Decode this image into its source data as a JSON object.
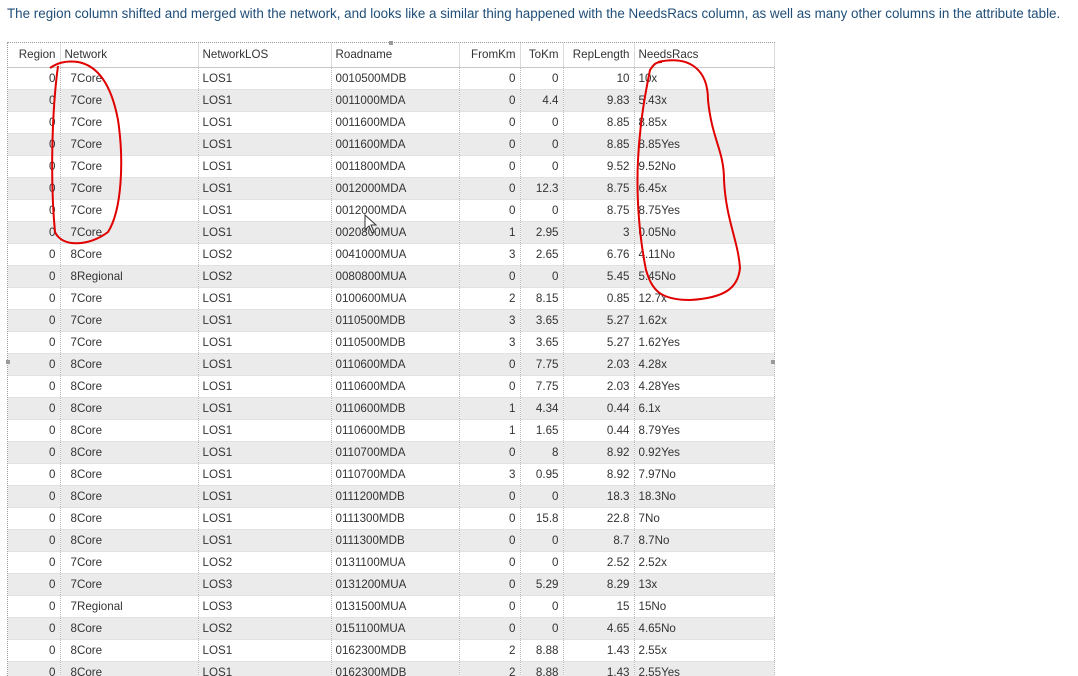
{
  "note": "The region column shifted and merged with the network, and looks like a similar thing happened with the NeedsRacs column, as well as many other columns in the attribute table.",
  "columns": [
    "Region",
    "Network",
    "NetworkLOS",
    "Roadname",
    "FromKm",
    "ToKm",
    "RepLength",
    "NeedsRacs"
  ],
  "rows": [
    [
      "0",
      "7Core",
      "LOS1",
      "0010500MDB",
      "0",
      "0",
      "10",
      "10x"
    ],
    [
      "0",
      "7Core",
      "LOS1",
      "0011000MDA",
      "0",
      "4.4",
      "9.83",
      "5.43x"
    ],
    [
      "0",
      "7Core",
      "LOS1",
      "0011600MDA",
      "0",
      "0",
      "8.85",
      "8.85x"
    ],
    [
      "0",
      "7Core",
      "LOS1",
      "0011600MDA",
      "0",
      "0",
      "8.85",
      "8.85Yes"
    ],
    [
      "0",
      "7Core",
      "LOS1",
      "0011800MDA",
      "0",
      "0",
      "9.52",
      "9.52No"
    ],
    [
      "0",
      "7Core",
      "LOS1",
      "0012000MDA",
      "0",
      "12.3",
      "8.75",
      "6.45x"
    ],
    [
      "0",
      "7Core",
      "LOS1",
      "0012000MDA",
      "0",
      "0",
      "8.75",
      "8.75Yes"
    ],
    [
      "0",
      "7Core",
      "LOS1",
      "0020800MUA",
      "1",
      "2.95",
      "3",
      "0.05No"
    ],
    [
      "0",
      "8Core",
      "LOS2",
      "0041000MUA",
      "3",
      "2.65",
      "6.76",
      "4.11No"
    ],
    [
      "0",
      "8Regional",
      "LOS2",
      "0080800MUA",
      "0",
      "0",
      "5.45",
      "5.45No"
    ],
    [
      "0",
      "7Core",
      "LOS1",
      "0100600MUA",
      "2",
      "8.15",
      "0.85",
      "12.7x"
    ],
    [
      "0",
      "7Core",
      "LOS1",
      "0110500MDB",
      "3",
      "3.65",
      "5.27",
      "1.62x"
    ],
    [
      "0",
      "7Core",
      "LOS1",
      "0110500MDB",
      "3",
      "3.65",
      "5.27",
      "1.62Yes"
    ],
    [
      "0",
      "8Core",
      "LOS1",
      "0110600MDA",
      "0",
      "7.75",
      "2.03",
      "4.28x"
    ],
    [
      "0",
      "8Core",
      "LOS1",
      "0110600MDA",
      "0",
      "7.75",
      "2.03",
      "4.28Yes"
    ],
    [
      "0",
      "8Core",
      "LOS1",
      "0110600MDB",
      "1",
      "4.34",
      "0.44",
      "6.1x"
    ],
    [
      "0",
      "8Core",
      "LOS1",
      "0110600MDB",
      "1",
      "1.65",
      "0.44",
      "8.79Yes"
    ],
    [
      "0",
      "8Core",
      "LOS1",
      "0110700MDA",
      "0",
      "8",
      "8.92",
      "0.92Yes"
    ],
    [
      "0",
      "8Core",
      "LOS1",
      "0110700MDA",
      "3",
      "0.95",
      "8.92",
      "7.97No"
    ],
    [
      "0",
      "8Core",
      "LOS1",
      "0111200MDB",
      "0",
      "0",
      "18.3",
      "18.3No"
    ],
    [
      "0",
      "8Core",
      "LOS1",
      "0111300MDB",
      "0",
      "15.8",
      "22.8",
      "7No"
    ],
    [
      "0",
      "8Core",
      "LOS1",
      "0111300MDB",
      "0",
      "0",
      "8.7",
      "8.7No"
    ],
    [
      "0",
      "7Core",
      "LOS2",
      "0131100MUA",
      "0",
      "0",
      "2.52",
      "2.52x"
    ],
    [
      "0",
      "7Core",
      "LOS3",
      "0131200MUA",
      "0",
      "5.29",
      "8.29",
      "13x"
    ],
    [
      "0",
      "7Regional",
      "LOS3",
      "0131500MUA",
      "0",
      "0",
      "15",
      "15No"
    ],
    [
      "0",
      "8Core",
      "LOS2",
      "0151100MUA",
      "0",
      "0",
      "4.65",
      "4.65No"
    ],
    [
      "0",
      "8Core",
      "LOS1",
      "0162300MDB",
      "2",
      "8.88",
      "1.43",
      "2.55x"
    ],
    [
      "0",
      "8Core",
      "LOS1",
      "0162300MDB",
      "2",
      "8.88",
      "1.43",
      "2.55Yes"
    ]
  ],
  "colors": {
    "note_text": "#1f4e79",
    "annotation": "#e00000",
    "alt_row": "#ebebeb"
  },
  "icons": {
    "cursor": "mouse-pointer-icon"
  }
}
